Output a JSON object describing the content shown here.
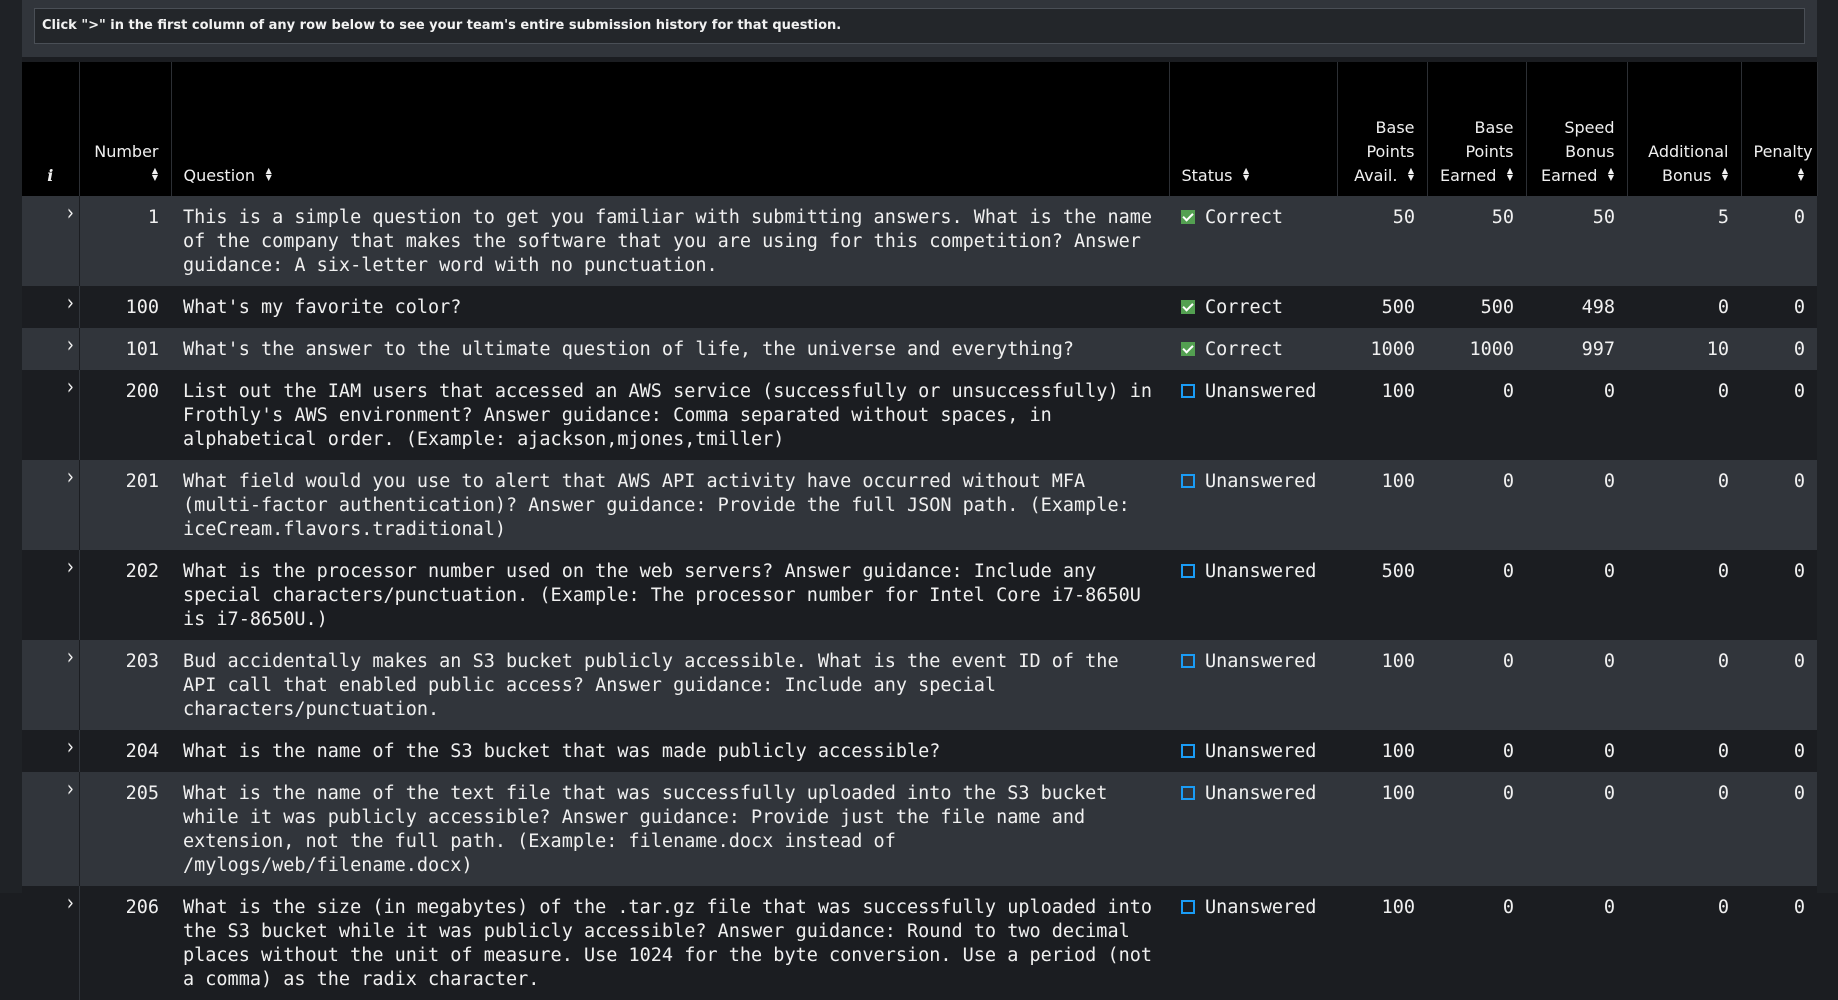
{
  "info": {
    "text": "Click \">\" in the first column of any row below to see your team's entire submission history for that question."
  },
  "table": {
    "headers": {
      "info": "i",
      "number": "Number",
      "question": "Question",
      "status": "Status",
      "base_avail": [
        "Base",
        "Points",
        "Avail."
      ],
      "base_earned": [
        "Base",
        "Points",
        "Earned"
      ],
      "speed_bonus": [
        "Speed",
        "Bonus",
        "Earned"
      ],
      "additional_bonus": [
        "Additional",
        "Bonus"
      ],
      "penalty": "Penalty"
    },
    "sort_icon": "sort-icon",
    "expand_glyph": "›",
    "status_colors": {
      "correct": "#53a051",
      "unanswered": "#1a9cf5"
    },
    "rows": [
      {
        "number": "1",
        "question": "This is a simple question to get you familiar with submitting answers. What is the name of the company that makes the software that you are using for this competition? Answer guidance: A six-letter word with no punctuation.",
        "status": "Correct",
        "status_type": "correct",
        "base_avail": "50",
        "base_earned": "50",
        "speed_bonus": "50",
        "additional_bonus": "5",
        "penalty": "0"
      },
      {
        "number": "100",
        "question": "What's my favorite color?",
        "status": "Correct",
        "status_type": "correct",
        "base_avail": "500",
        "base_earned": "500",
        "speed_bonus": "498",
        "additional_bonus": "0",
        "penalty": "0"
      },
      {
        "number": "101",
        "question": "What's the answer to the ultimate question of life, the universe and everything?",
        "status": "Correct",
        "status_type": "correct",
        "base_avail": "1000",
        "base_earned": "1000",
        "speed_bonus": "997",
        "additional_bonus": "10",
        "penalty": "0"
      },
      {
        "number": "200",
        "question": "List out the IAM users that accessed an AWS service (successfully or unsuccessfully) in Frothly's AWS environment? Answer guidance: Comma separated without spaces, in alphabetical order. (Example: ajackson,mjones,tmiller)",
        "status": "Unanswered",
        "status_type": "unanswered",
        "base_avail": "100",
        "base_earned": "0",
        "speed_bonus": "0",
        "additional_bonus": "0",
        "penalty": "0"
      },
      {
        "number": "201",
        "question": "What field would you use to alert that AWS API activity have occurred without MFA (multi-factor authentication)? Answer guidance: Provide the full JSON path. (Example: iceCream.flavors.traditional)",
        "status": "Unanswered",
        "status_type": "unanswered",
        "base_avail": "100",
        "base_earned": "0",
        "speed_bonus": "0",
        "additional_bonus": "0",
        "penalty": "0"
      },
      {
        "number": "202",
        "question": "What is the processor number used on the web servers? Answer guidance: Include any special characters/punctuation. (Example: The processor number for Intel Core i7-8650U is i7-8650U.)",
        "status": "Unanswered",
        "status_type": "unanswered",
        "base_avail": "500",
        "base_earned": "0",
        "speed_bonus": "0",
        "additional_bonus": "0",
        "penalty": "0"
      },
      {
        "number": "203",
        "question": "Bud accidentally makes an S3 bucket publicly accessible. What is the event ID of the API call that enabled public access? Answer guidance: Include any special characters/punctuation.",
        "status": "Unanswered",
        "status_type": "unanswered",
        "base_avail": "100",
        "base_earned": "0",
        "speed_bonus": "0",
        "additional_bonus": "0",
        "penalty": "0"
      },
      {
        "number": "204",
        "question": "What is the name of the S3 bucket that was made publicly accessible?",
        "status": "Unanswered",
        "status_type": "unanswered",
        "base_avail": "100",
        "base_earned": "0",
        "speed_bonus": "0",
        "additional_bonus": "0",
        "penalty": "0"
      },
      {
        "number": "205",
        "question": "What is the name of the text file that was successfully uploaded into the S3 bucket while it was publicly accessible? Answer guidance: Provide just the file name and extension, not the full path. (Example: filename.docx instead of /mylogs/web/filename.docx)",
        "status": "Unanswered",
        "status_type": "unanswered",
        "base_avail": "100",
        "base_earned": "0",
        "speed_bonus": "0",
        "additional_bonus": "0",
        "penalty": "0"
      },
      {
        "number": "206",
        "question": "What is the size (in megabytes) of the .tar.gz file that was successfully uploaded into the S3 bucket while it was publicly accessible? Answer guidance: Round to two decimal places without the unit of measure. Use 1024 for the byte conversion. Use a period (not a comma) as the radix character.",
        "status": "Unanswered",
        "status_type": "unanswered",
        "base_avail": "100",
        "base_earned": "0",
        "speed_bonus": "0",
        "additional_bonus": "0",
        "penalty": "0"
      }
    ]
  }
}
